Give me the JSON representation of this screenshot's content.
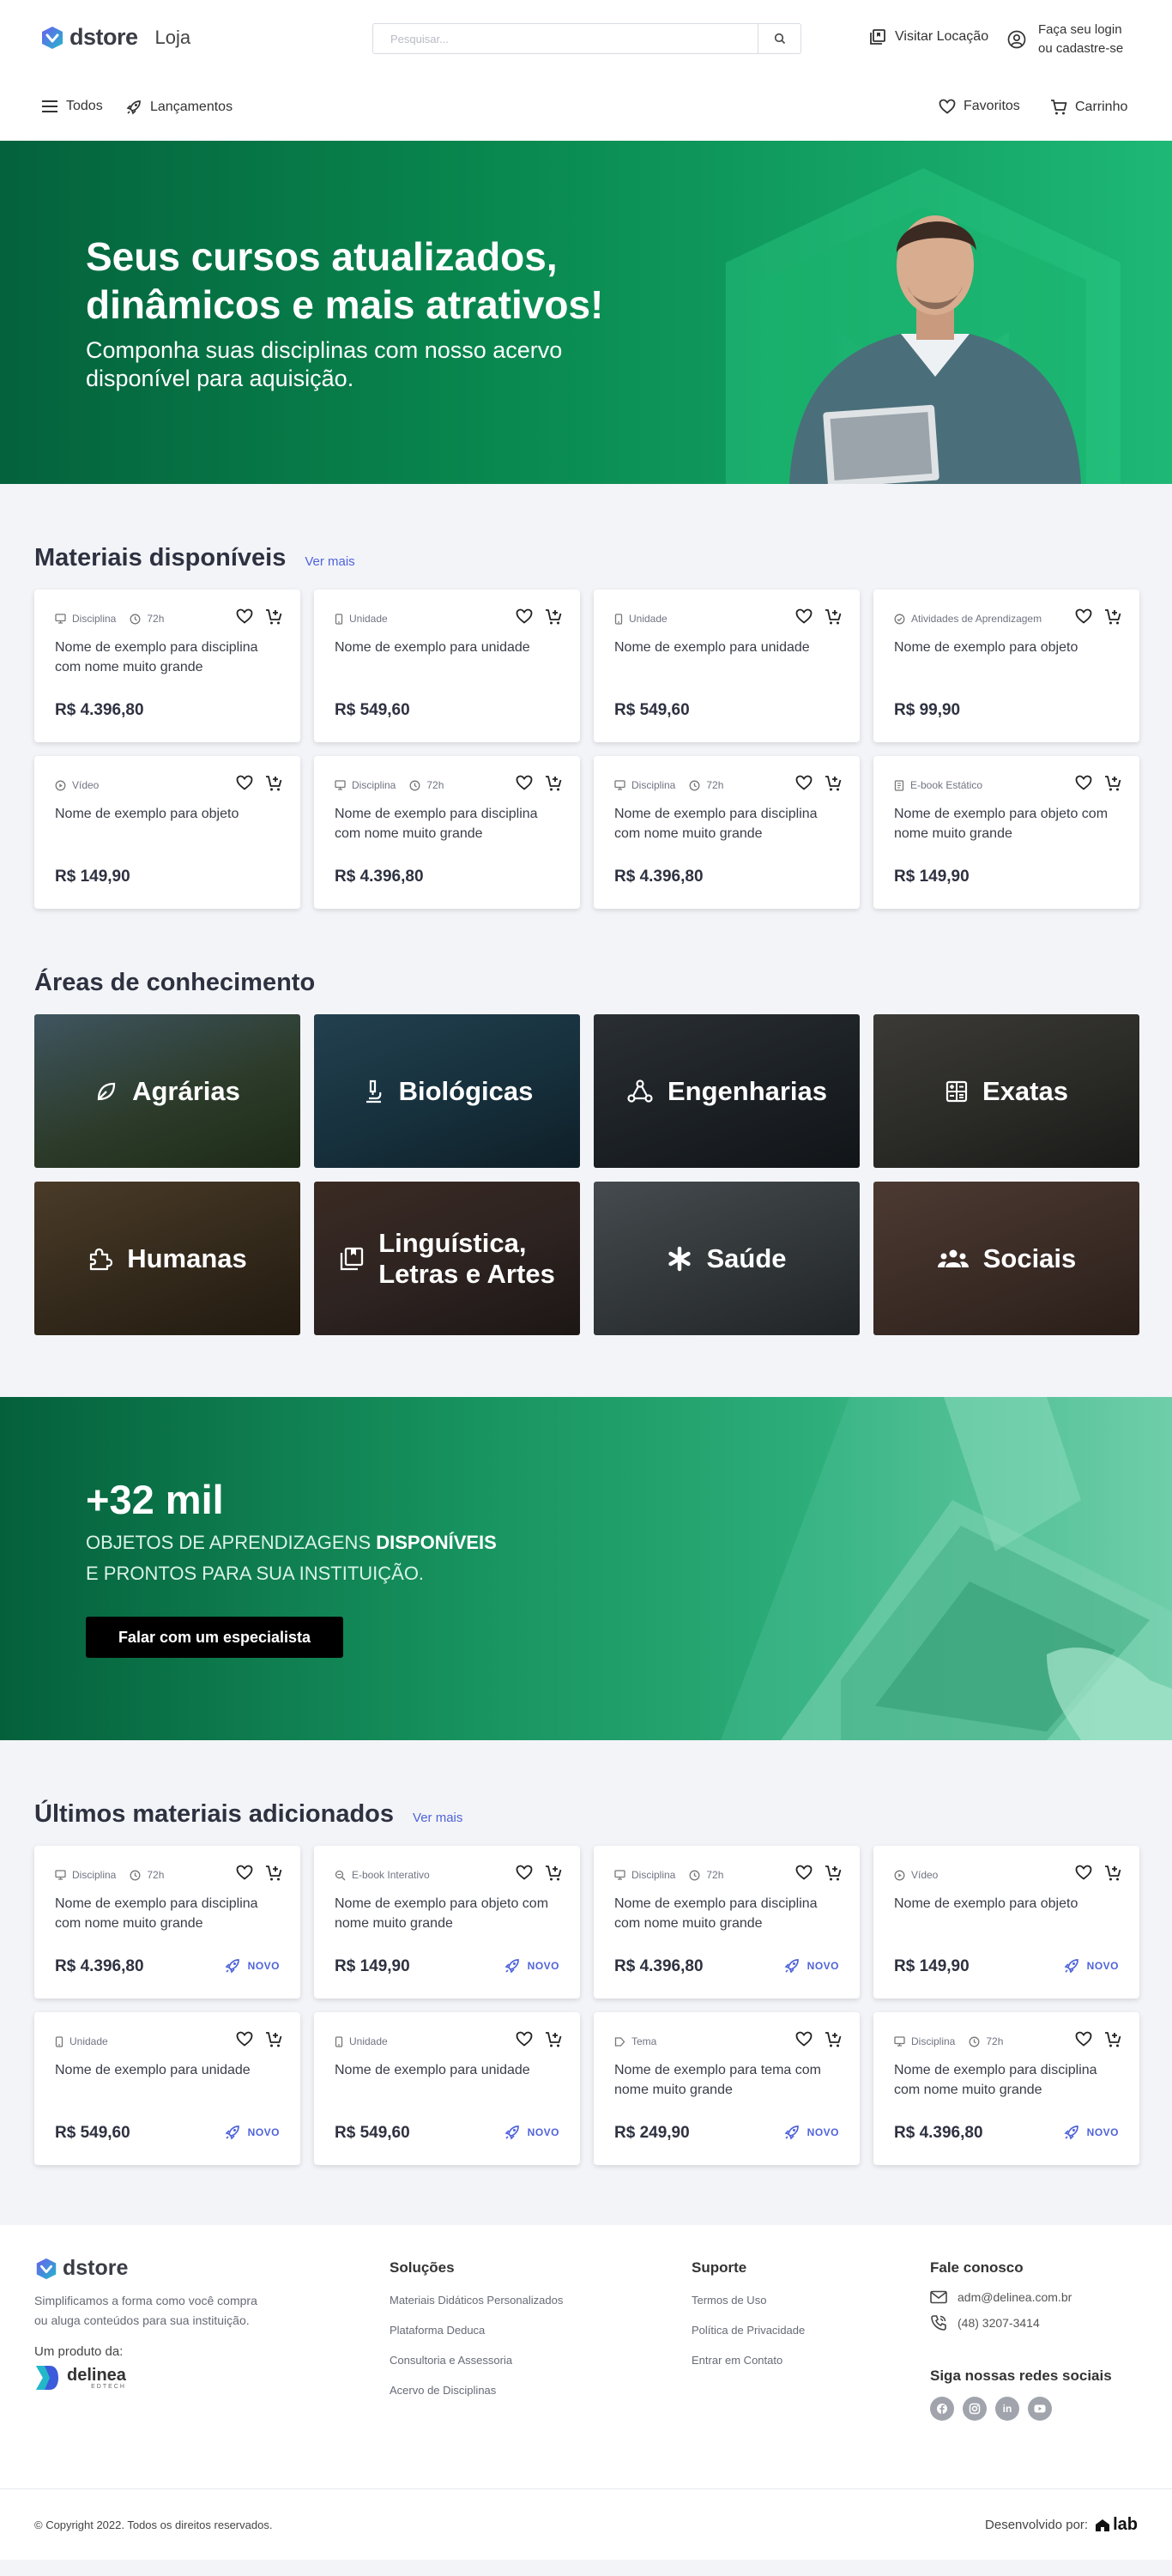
{
  "header": {
    "logo_text": "dstore",
    "store_label": "Loja",
    "search_placeholder": "Pesquisar...",
    "visit_label": "Visitar Locação",
    "login_line1": "Faça seu login",
    "login_line2": "ou cadastre-se"
  },
  "nav": {
    "all": "Todos",
    "launches": "Lançamentos",
    "favorites": "Favoritos",
    "cart": "Carrinho"
  },
  "hero": {
    "title": "Seus cursos atualizados, dinâmicos e mais atrativos!",
    "subtitle": "Componha suas disciplinas com nosso acervo disponível para aquisição."
  },
  "materials": {
    "title": "Materiais disponíveis",
    "see_more": "Ver mais",
    "items": [
      {
        "type": "Disciplina",
        "duration": "72h",
        "name": "Nome de exemplo para disciplina com nome muito grande",
        "price": "R$ 4.396,80",
        "icon": "monitor-icon"
      },
      {
        "type": "Unidade",
        "duration": "",
        "name": "Nome de exemplo para unidade",
        "price": "R$ 549,60",
        "icon": "phone-icon"
      },
      {
        "type": "Unidade",
        "duration": "",
        "name": "Nome de exemplo para unidade",
        "price": "R$ 549,60",
        "icon": "phone-icon"
      },
      {
        "type": "Atividades de Aprendizagem",
        "duration": "",
        "name": "Nome de exemplo para objeto",
        "price": "R$ 99,90",
        "icon": "check-circle-icon"
      },
      {
        "type": "Vídeo",
        "duration": "",
        "name": "Nome de exemplo para objeto",
        "price": "R$ 149,90",
        "icon": "play-circle-icon"
      },
      {
        "type": "Disciplina",
        "duration": "72h",
        "name": "Nome de exemplo para disciplina com nome muito grande",
        "price": "R$ 4.396,80",
        "icon": "monitor-icon"
      },
      {
        "type": "Disciplina",
        "duration": "72h",
        "name": "Nome de exemplo para disciplina com nome muito grande",
        "price": "R$ 4.396,80",
        "icon": "monitor-icon"
      },
      {
        "type": "E-book Estático",
        "duration": "",
        "name": "Nome de exemplo para objeto com nome muito grande",
        "price": "R$ 149,90",
        "icon": "book-icon"
      }
    ]
  },
  "areas": {
    "title": "Áreas de conhecimento",
    "items": [
      {
        "label": "Agrárias",
        "icon": "leaf-icon",
        "colors": [
          "#3f5560",
          "#2c3b2a",
          "#1e2a17"
        ]
      },
      {
        "label": "Biológicas",
        "icon": "microscope-icon",
        "colors": [
          "#23404f",
          "#16303c",
          "#0f1f28"
        ]
      },
      {
        "label": "Engenharias",
        "icon": "nodes-icon",
        "colors": [
          "#2a2f33",
          "#1b2024",
          "#121518"
        ]
      },
      {
        "label": "Exatas",
        "icon": "calculator-icon",
        "colors": [
          "#3b3a36",
          "#2a2a27",
          "#1a1a18"
        ]
      },
      {
        "label": "Humanas",
        "icon": "puzzle-icon",
        "colors": [
          "#4a3b28",
          "#33291b",
          "#221a10"
        ]
      },
      {
        "label": "Linguística, Letras e Artes",
        "icon": "library-icon",
        "colors": [
          "#3a2a22",
          "#2d2321",
          "#1c1614"
        ]
      },
      {
        "label": "Saúde",
        "icon": "asterisk-icon",
        "colors": [
          "#454b4e",
          "#313638",
          "#202426"
        ]
      },
      {
        "label": "Sociais",
        "icon": "people-icon",
        "colors": [
          "#4c3a32",
          "#3a2b25",
          "#2a1e19"
        ]
      }
    ]
  },
  "promo": {
    "big": "+32 mil",
    "line1a": "OBJETOS DE APRENDIZAGENS ",
    "line1b": "DISPONÍVEIS",
    "line2": "E PRONTOS PARA SUA INSTITUIÇÃO.",
    "button": "Falar com um especialista"
  },
  "latest": {
    "title": "Últimos materiais adicionados",
    "see_more": "Ver mais",
    "badge": "NOVO",
    "items": [
      {
        "type": "Disciplina",
        "duration": "72h",
        "name": "Nome de exemplo para disciplina com nome muito grande",
        "price": "R$ 4.396,80",
        "icon": "monitor-icon"
      },
      {
        "type": "E-book Interativo",
        "duration": "",
        "name": "Nome de exemplo para objeto com nome muito grande",
        "price": "R$ 149,90",
        "icon": "search-book-icon"
      },
      {
        "type": "Disciplina",
        "duration": "72h",
        "name": "Nome de exemplo para disciplina com nome muito grande",
        "price": "R$ 4.396,80",
        "icon": "monitor-icon"
      },
      {
        "type": "Vídeo",
        "duration": "",
        "name": "Nome de exemplo para objeto",
        "price": "R$ 149,90",
        "icon": "play-circle-icon"
      },
      {
        "type": "Unidade",
        "duration": "",
        "name": "Nome de exemplo para unidade",
        "price": "R$ 549,60",
        "icon": "phone-icon"
      },
      {
        "type": "Unidade",
        "duration": "",
        "name": "Nome de exemplo para unidade",
        "price": "R$ 549,60",
        "icon": "phone-icon"
      },
      {
        "type": "Tema",
        "duration": "",
        "name": "Nome de exemplo para tema com nome muito grande",
        "price": "R$ 249,90",
        "icon": "tag-icon"
      },
      {
        "type": "Disciplina",
        "duration": "72h",
        "name": "Nome de exemplo para disciplina com nome muito grande",
        "price": "R$ 4.396,80",
        "icon": "monitor-icon"
      }
    ]
  },
  "footer": {
    "logo_text": "dstore",
    "description": "Simplificamos a forma como você compra ou aluga conteúdos para sua instituição.",
    "product_of": "Um produto da:",
    "partner_name": "delinea",
    "partner_sub": "EDTECH",
    "solutions_title": "Soluções",
    "solutions": [
      "Materiais Didáticos Personalizados",
      "Plataforma Deduca",
      "Consultoria e Assessoria",
      "Acervo de Disciplinas"
    ],
    "support_title": "Suporte",
    "support": [
      "Termos de Uso",
      "Política de Privacidade",
      "Entrar em Contato"
    ],
    "contact_title": "Fale conosco",
    "email": "adm@delinea.com.br",
    "phone": "(48) 3207-3414",
    "social_title": "Siga nossas redes sociais",
    "copyright": "© Copyright 2022. Todos os direitos reservados.",
    "developed_by": "Desenvolvido por:",
    "dev_brand": "lab"
  },
  "colors": {
    "brand_green": "#0a8a50",
    "accent_blue": "#4f63d9",
    "dark_text": "#2e3140"
  }
}
